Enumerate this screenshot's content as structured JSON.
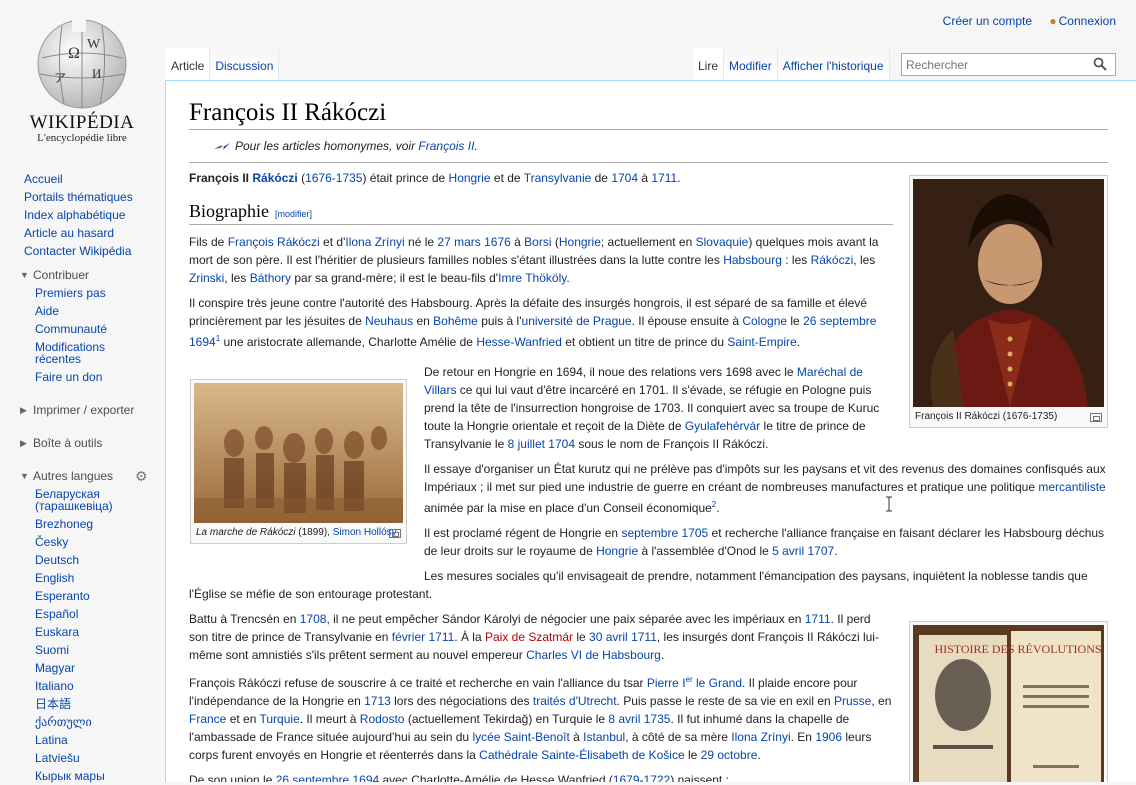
{
  "personal": {
    "create_account": "Créer un compte",
    "login": "Connexion"
  },
  "logo": {
    "wordmark": "WIKIPÉDIA",
    "tagline": "L'encyclopédie libre"
  },
  "sidebar": {
    "nav": [
      "Accueil",
      "Portails thématiques",
      "Index alphabétique",
      "Article au hasard",
      "Contacter Wikipédia"
    ],
    "contribute": {
      "title": "Contribuer",
      "items": [
        "Premiers pas",
        "Aide",
        "Communauté",
        "Modifications récentes",
        "Faire un don"
      ]
    },
    "print": "Imprimer / exporter",
    "tools": "Boîte à outils",
    "languages": {
      "title": "Autres langues",
      "items": [
        "Беларуская (тарашкевіца)",
        "Brezhoneg",
        "Česky",
        "Deutsch",
        "English",
        "Esperanto",
        "Español",
        "Euskara",
        "Suomi",
        "Magyar",
        "Italiano",
        "日本語",
        "ქართული",
        "Latina",
        "Latviešu",
        "Кырык мары"
      ]
    }
  },
  "tabs": {
    "article": "Article",
    "discussion": "Discussion",
    "read": "Lire",
    "edit": "Modifier",
    "history": "Afficher l'historique"
  },
  "search": {
    "placeholder": "Rechercher"
  },
  "article": {
    "title": "François II Rákóczi",
    "hatnote": {
      "prefix": "Pour les articles homonymes, voir ",
      "link": "François II",
      "suffix": "."
    },
    "intro": {
      "name": "François II",
      "link_name": "Rákóczi",
      "dates": "1676-1735",
      "t1": " était prince de ",
      "hongrie": "Hongrie",
      "t2": " et de ",
      "transylvanie": "Transylvanie",
      "t3": " de ",
      "y1": "1704",
      "t4": " à ",
      "y2": "1711",
      "t5": "."
    },
    "section": "Biographie",
    "section_edit": "[modifier]",
    "thumb1_caption": "François II Rákóczi (1676-1735)",
    "thumb2_caption_title": "La marche de Rákóczi",
    "thumb2_caption_year": " (1899), ",
    "thumb2_caption_author": "Simon Hollósy",
    "thumb3_book_title": "HISTOIRE DES RÉVOLUTIONS DE HONGRIE"
  }
}
